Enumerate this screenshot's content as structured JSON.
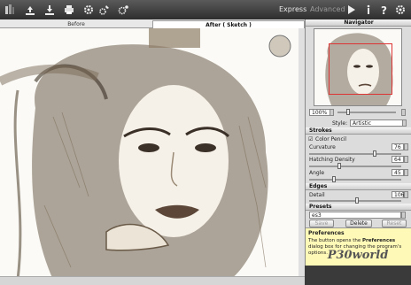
{
  "toolbar": {
    "modes": {
      "express": "Express",
      "advanced": "Advanced"
    }
  },
  "canvas": {
    "tabs": {
      "before": "Before",
      "after": "After ( Sketch )"
    }
  },
  "navigator": {
    "title": "Navigator",
    "zoom": "100%"
  },
  "style": {
    "label": "Style:",
    "value": "Artistic"
  },
  "strokes": {
    "title": "Strokes",
    "color_pencil": "Color Pencil",
    "curvature_label": "Curvature",
    "curvature_value": "76",
    "hatching_label": "Hatching Density",
    "hatching_value": "64",
    "angle_label": "Angle",
    "angle_value": "45"
  },
  "edges": {
    "title": "Edges",
    "detail_label": "Detail",
    "detail_value": "106"
  },
  "presets": {
    "title": "Presets",
    "value": "es3",
    "save": "Save",
    "delete": "Delete",
    "reset": "Reset"
  },
  "help": {
    "title": "Preferences",
    "pre": "The button opens the ",
    "bold": "Preferences",
    "post": " dialog box for changing the program's options."
  },
  "watermark": "P30world"
}
